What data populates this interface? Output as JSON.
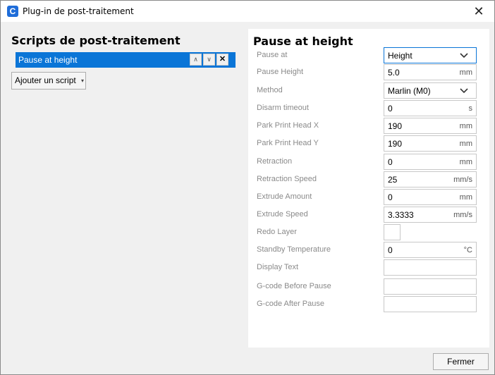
{
  "window": {
    "title": "Plug-in de post-traitement",
    "close_glyph": "✕"
  },
  "app_icon": {
    "name": "cura-app-icon",
    "glyph": "C"
  },
  "left": {
    "heading": "Scripts de post-traitement",
    "scripts": [
      {
        "label": "Pause at height",
        "selected": true
      }
    ],
    "move_up_glyph": "∧",
    "move_down_glyph": "∨",
    "remove_glyph": "✕",
    "add_script_label": "Ajouter un script",
    "add_script_caret": "▾"
  },
  "panel": {
    "heading": "Pause at height",
    "settings": [
      {
        "label": "Pause at",
        "type": "dropdown",
        "value": "Height"
      },
      {
        "label": "Pause Height",
        "type": "text",
        "value": "5.0",
        "unit": "mm"
      },
      {
        "label": "Method",
        "type": "dropdown",
        "value": "Marlin (M0)"
      },
      {
        "label": "Disarm timeout",
        "type": "text",
        "value": "0",
        "unit": "s"
      },
      {
        "label": "Park Print Head X",
        "type": "text",
        "value": "190",
        "unit": "mm"
      },
      {
        "label": "Park Print Head Y",
        "type": "text",
        "value": "190",
        "unit": "mm"
      },
      {
        "label": "Retraction",
        "type": "text",
        "value": "0",
        "unit": "mm"
      },
      {
        "label": "Retraction Speed",
        "type": "text",
        "value": "25",
        "unit": "mm/s"
      },
      {
        "label": "Extrude Amount",
        "type": "text",
        "value": "0",
        "unit": "mm"
      },
      {
        "label": "Extrude Speed",
        "type": "text",
        "value": "3.3333",
        "unit": "mm/s"
      },
      {
        "label": "Redo Layer",
        "type": "checkbox",
        "checked": false
      },
      {
        "label": "Standby Temperature",
        "type": "text",
        "value": "0",
        "unit": "°C"
      },
      {
        "label": "Display Text",
        "type": "text",
        "value": "",
        "unit": ""
      },
      {
        "label": "G-code Before Pause",
        "type": "text",
        "value": "",
        "unit": ""
      },
      {
        "label": "G-code After Pause",
        "type": "text",
        "value": "",
        "unit": ""
      }
    ]
  },
  "footer": {
    "close_label": "Fermer"
  },
  "colors": {
    "accent": "#0a75d7",
    "label_gray": "#8a8a8a"
  }
}
